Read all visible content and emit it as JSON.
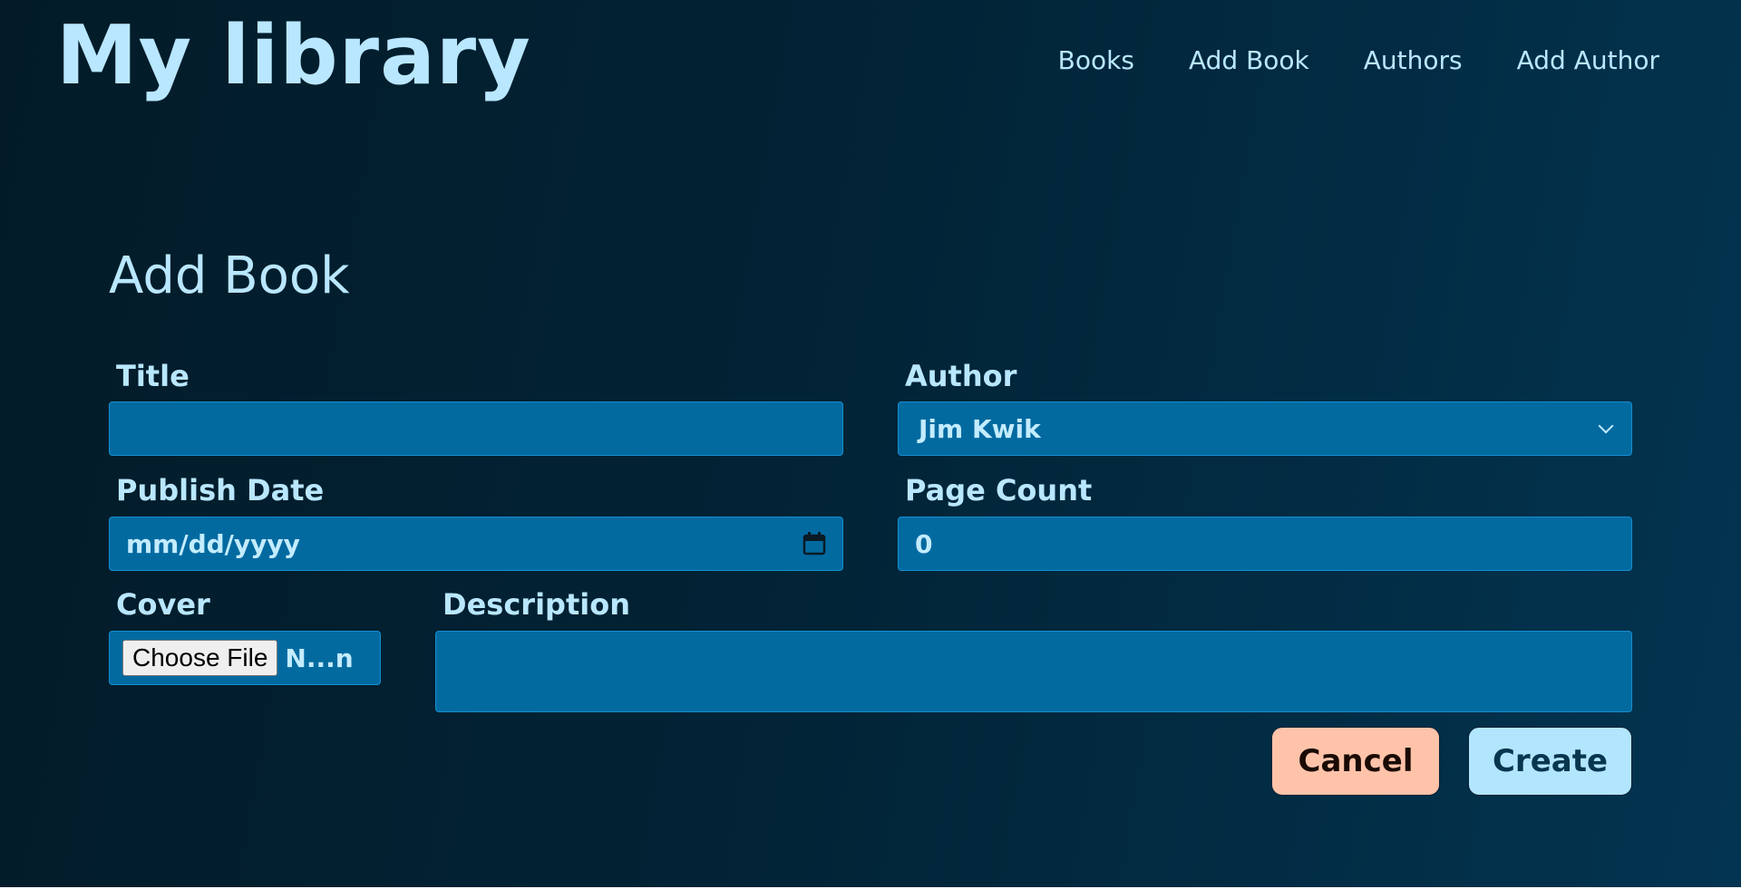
{
  "header": {
    "site_title": "My library",
    "nav": [
      {
        "label": "Books"
      },
      {
        "label": "Add Book"
      },
      {
        "label": "Authors"
      },
      {
        "label": "Add Author"
      }
    ]
  },
  "form": {
    "heading": "Add Book",
    "title": {
      "label": "Title",
      "value": ""
    },
    "author": {
      "label": "Author",
      "selected": "Jim Kwik"
    },
    "publish_date": {
      "label": "Publish Date",
      "placeholder": "mm/dd/yyyy"
    },
    "page_count": {
      "label": "Page Count",
      "value": "0"
    },
    "cover": {
      "label": "Cover",
      "button_label": "Choose File",
      "status": "N...n"
    },
    "description": {
      "label": "Description",
      "value": ""
    },
    "cancel_label": "Cancel",
    "create_label": "Create"
  },
  "icons": {
    "calendar": "calendar-icon",
    "dropdown": "chevron-down-icon"
  },
  "colors": {
    "background": "#022437",
    "text": "#b9e7ff",
    "field_bg": "#036aa0",
    "field_border": "#158ed1",
    "cancel_bg": "#ffc3aa",
    "create_bg": "#b2e6ff"
  }
}
